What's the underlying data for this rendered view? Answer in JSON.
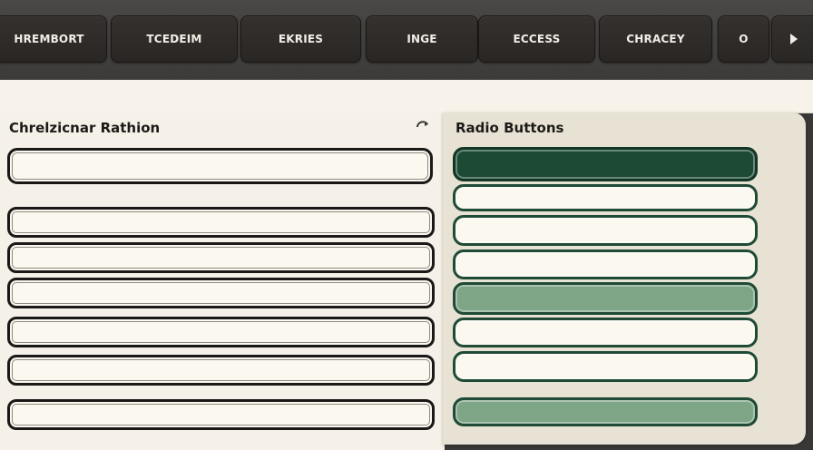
{
  "tabs": [
    {
      "label": "HREMBORT",
      "state": "default"
    },
    {
      "label": "TCEDEIM",
      "state": "default"
    },
    {
      "label": "EKRIES",
      "state": "default"
    },
    {
      "label": "INGE",
      "state": "default"
    },
    {
      "label": "ECCESS",
      "state": "default"
    },
    {
      "label": "CHRACEY",
      "state": "default"
    },
    {
      "label": "O",
      "state": "default"
    }
  ],
  "icons": {
    "refresh": "refresh-icon",
    "more": "chevron-right-icon"
  },
  "left_panel": {
    "title": "Chrelzicnar Rathion",
    "checkboxes": [
      {
        "state": "unchecked"
      },
      {
        "state": "unchecked"
      },
      {
        "state": "unchecked"
      },
      {
        "state": "unchecked"
      },
      {
        "state": "unchecked"
      },
      {
        "state": "unchecked"
      },
      {
        "state": "unchecked"
      }
    ]
  },
  "right_panel": {
    "title": "Radio Buttons",
    "options": [
      {
        "state": "selected"
      },
      {
        "state": "unselected"
      },
      {
        "state": "unselected"
      },
      {
        "state": "unselected"
      },
      {
        "state": "partial"
      },
      {
        "state": "unselected"
      },
      {
        "state": "unselected"
      },
      {
        "state": "partial"
      }
    ]
  },
  "colors": {
    "topbar": "#3d3b39",
    "tab": "#2a2624",
    "panel": "#f5f1e8",
    "radio_selected": "#1c4a35",
    "radio_partial": "#7ea586"
  }
}
